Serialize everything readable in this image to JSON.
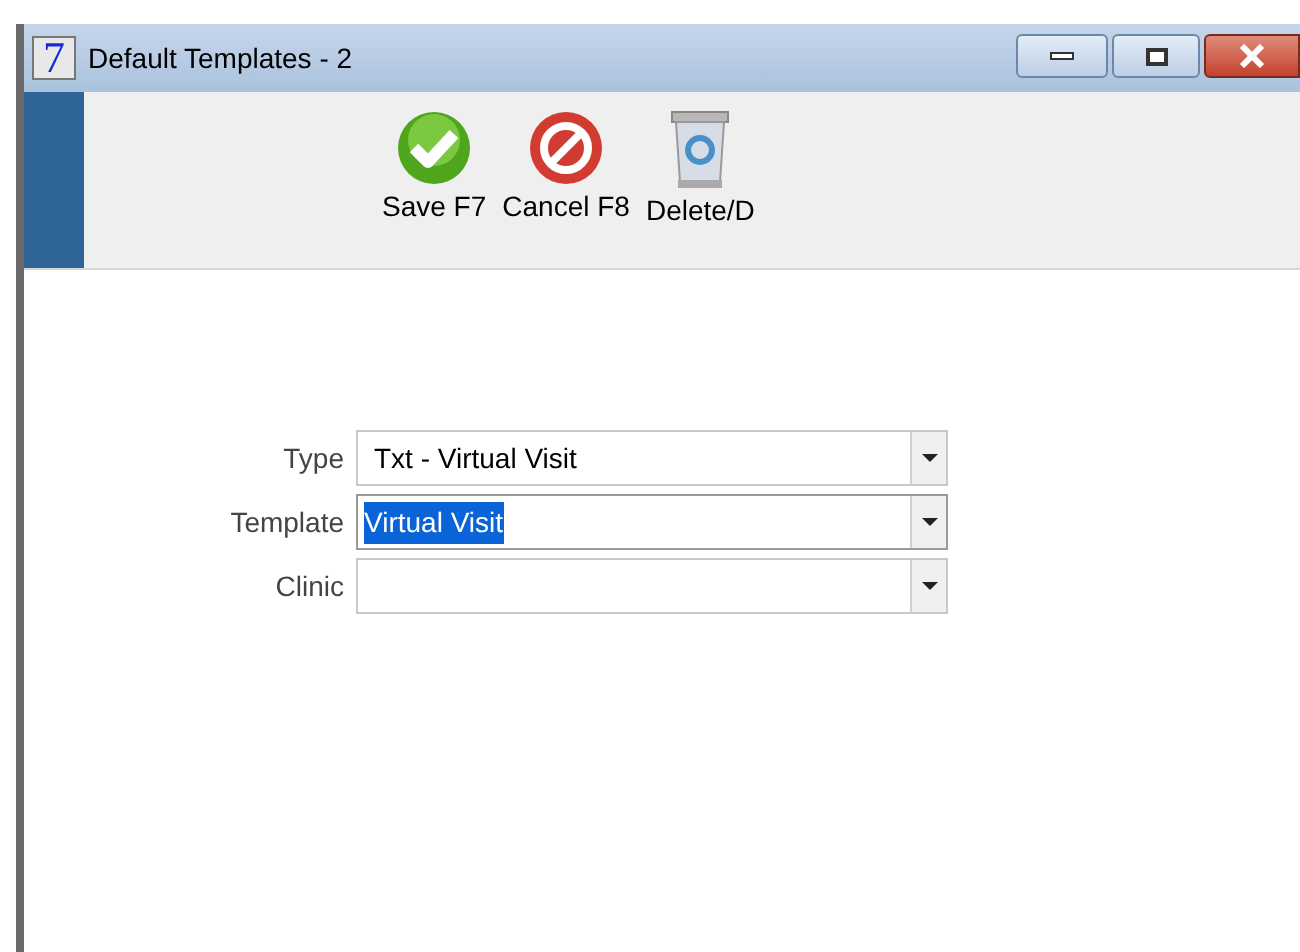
{
  "window": {
    "title": "Default Templates - 2",
    "app_icon": "7"
  },
  "toolbar": [
    {
      "kind": "save",
      "label": "Save F7"
    },
    {
      "kind": "cancel",
      "label": "Cancel F8"
    },
    {
      "kind": "delete",
      "label": "Delete/D"
    }
  ],
  "fields": [
    {
      "label": "Type",
      "value": "Txt - Virtual Visit",
      "highlighted": false
    },
    {
      "label": "Template",
      "value": "Virtual Visit",
      "highlighted": true
    },
    {
      "label": "Clinic",
      "highlighted": false
    }
  ]
}
